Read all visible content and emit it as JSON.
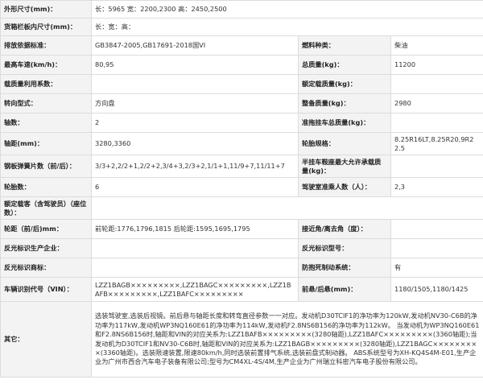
{
  "rows": [
    {
      "type": "full",
      "label": "外形尺寸(mm)：",
      "value": "长：5965 宽：2200,2300 高：2450,2500"
    },
    {
      "type": "full",
      "label": "货箱栏板内尺寸(mm)：",
      "value": "长：宽：高："
    },
    {
      "type": "pair",
      "l1": "排放依据标准：",
      "v1": "GB3847-2005,GB17691-2018国VI",
      "l2": "燃料种类：",
      "v2": "柴油"
    },
    {
      "type": "pair",
      "l1": "最高车速(km/h)：",
      "v1": "80,95",
      "l2": "总质量(kg)：",
      "v2": "11200"
    },
    {
      "type": "pair",
      "l1": "载质量利用系数：",
      "v1": "",
      "l2": "额定载质量(kg)：",
      "v2": ""
    },
    {
      "type": "pair",
      "l1": "转向型式：",
      "v1": "方向盘",
      "l2": "整备质量(kg)：",
      "v2": "2980"
    },
    {
      "type": "pair",
      "l1": "轴数：",
      "v1": "2",
      "l2": "准拖挂车总质量(kg)：",
      "v2": ""
    },
    {
      "type": "pair",
      "l1": "轴距(mm)：",
      "v1": "3280,3360",
      "l2": "轮胎规格：",
      "v2": "8.25R16LT,8.25R20,9R22.5"
    },
    {
      "type": "pair",
      "l1": "钢板弹簧片数（前/后）：",
      "v1": "3/3+2,2/2+1,2/2+2,3/4+3,2/3+2,1/1+1,11/9+7,11/11+7",
      "l2": "半挂车鞍座最大允许承载质量(kg)：",
      "v2": ""
    },
    {
      "type": "pair",
      "l1": "轮胎数：",
      "v1": "6",
      "l2": "驾驶室准乘人数（人）：",
      "v2": "2,3"
    },
    {
      "type": "full",
      "label": "额定载客（含驾驶员）（座位数）：",
      "value": ""
    },
    {
      "type": "pair",
      "l1": "轮距（前/后)mm：",
      "v1": "前轮距:1776,1796,1815 后轮距:1595,1695,1795",
      "l2": "接近角/离去角（度）：",
      "v2": ""
    },
    {
      "type": "pair",
      "l1": "反光标识生产企业：",
      "v1": "",
      "l2": "反光标识型号：",
      "v2": ""
    },
    {
      "type": "pair",
      "l1": "反光标识商标：",
      "v1": "",
      "l2": "防抱死制动系统：",
      "v2": "有"
    },
    {
      "type": "pair",
      "l1": "车辆识别代号（VIN）：",
      "v1": "LZZ1BAGB×××××××××,LZZ1BAGC×××××××××,LZZ1BAFB×××××××××,LZZ1BAFC×××××××××",
      "l2": "前悬/后悬(mm)：",
      "v2": "1180/1505,1180/1425"
    },
    {
      "type": "other",
      "label": "其它：",
      "value": "选装驾驶室,选装后视镜。前后悬与轴距长度和转弯直径参数一一对应。发动机D30TCIF1的净功率为120kW,发动机NV30-C6B的净功率为117kW,发动机WP3NQ160E61的净功率为114kW,发动机F2.8NS6B156的净功率为112kW。 当发动机为WP3NQ160E61和F2.8NS6B156时,轴距和VIN的对应关系为:LZZ1BAFB×××××××××(3280轴距),LZZ1BAFC×××××××××(3360轴距);当发动机为D30TCIF1和NV30-C6B时,轴距和VIN的对应关系为:LZZ1BAGB×××××××××(3280轴距),LZZ1BAGC×××××××××(3360轴距)。选装限速装置,限速80km/h,同时选装前置排气系统,选装前盘式制动器。 ABS系统型号为XH-KQ4S4M-E01,生产企业为广州市西合汽车电子装备有限公司;型号为CM4XL-4S/4M,生产企业为广州瑞立科密汽车电子股份有限公司。"
    }
  ]
}
